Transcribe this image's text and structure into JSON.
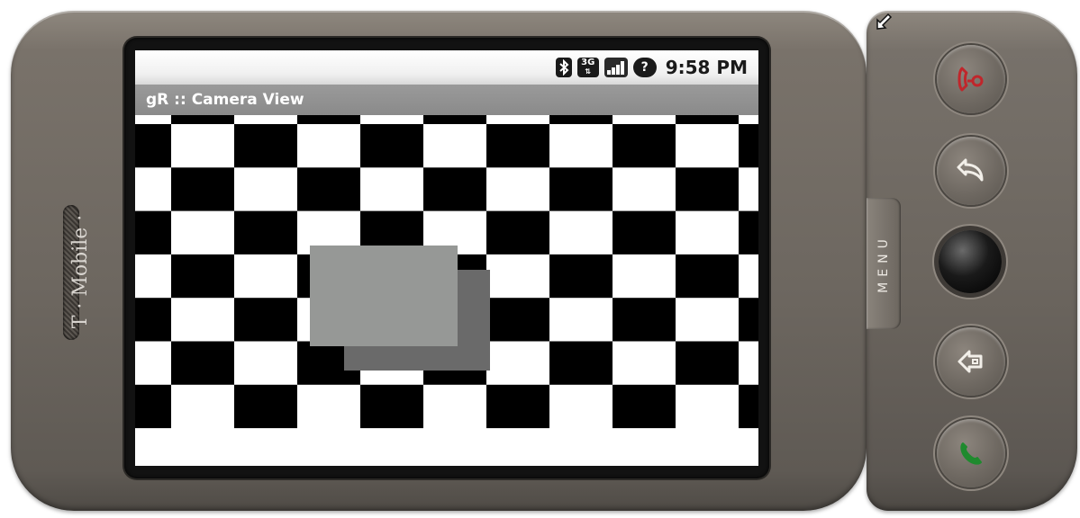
{
  "device": {
    "brand": "T · Mobile ·",
    "menu_key": "MENU"
  },
  "status_bar": {
    "icons": [
      "bluetooth-icon",
      "3g-data-icon",
      "signal-strength-icon",
      "no-sim-icon"
    ],
    "data_network": "3G",
    "sim_status": "?",
    "clock": "9:58 PM"
  },
  "app": {
    "title": "gR :: Camera View"
  },
  "hardware_buttons": [
    "end-call-button",
    "back-button",
    "trackball",
    "home-button",
    "call-button"
  ],
  "colors": {
    "end_call": "#c0262b",
    "call": "#1f8a2e",
    "device_body": "#6d6760",
    "title_bar": "#8f8f8f"
  }
}
